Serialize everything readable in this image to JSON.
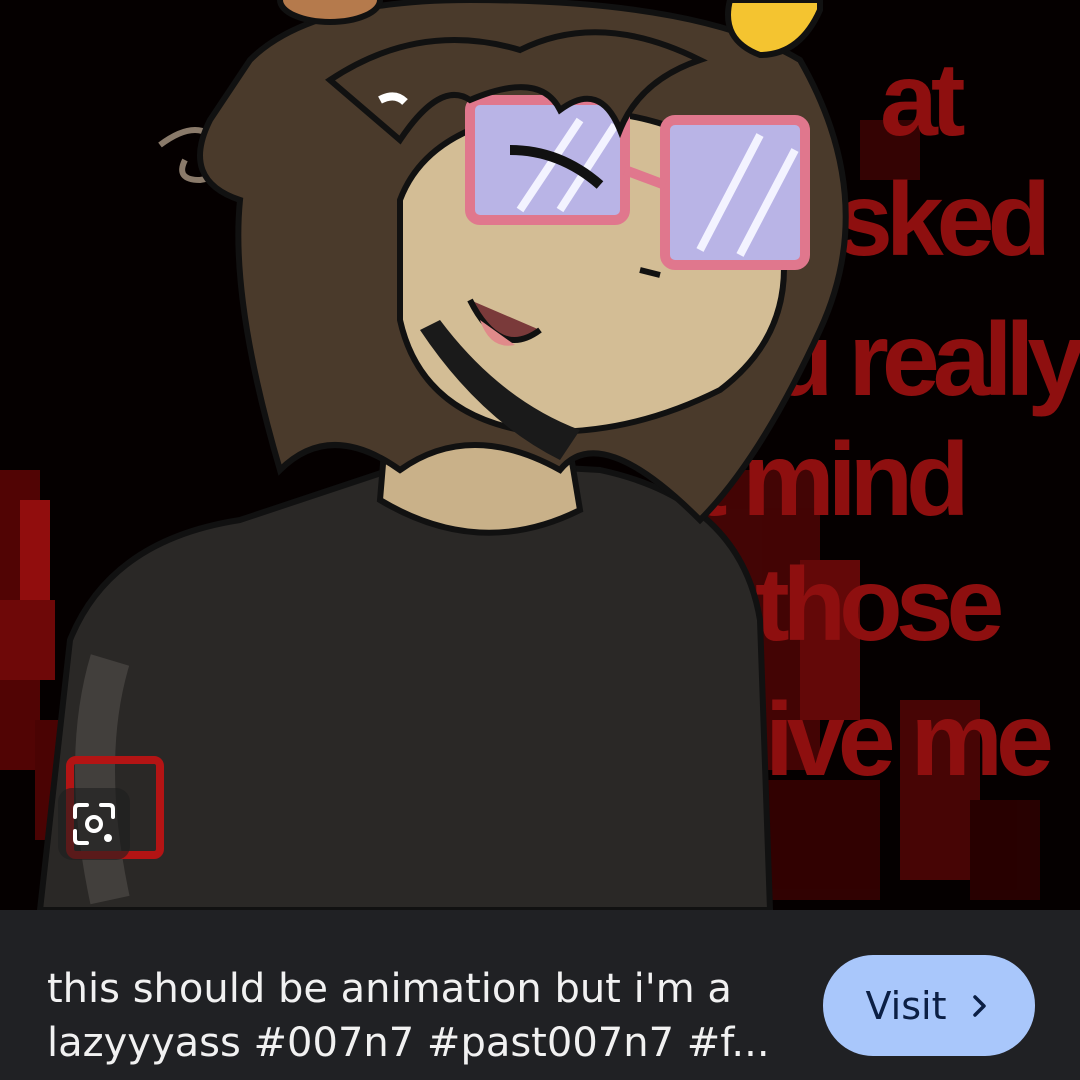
{
  "image": {
    "subject": "digital illustration of character with pink rectangular glasses, brown messy hair, black shirt",
    "background_text_lines": [
      "at",
      "sked",
      "u really",
      "'t mind",
      "those",
      "ive me"
    ]
  },
  "lens": {
    "icon": "lens-search-icon"
  },
  "result": {
    "caption": "this should be animation but i'm a lazyyyass #007n7 #past007n7 #f...",
    "visit_label": "Visit",
    "visit_icon": "chevron-right-icon"
  },
  "colors": {
    "bar_background": "#202124",
    "visit_button": "#a9c7fb",
    "caption_text": "#f1f1f1",
    "background_red": "#8e0f0f"
  }
}
